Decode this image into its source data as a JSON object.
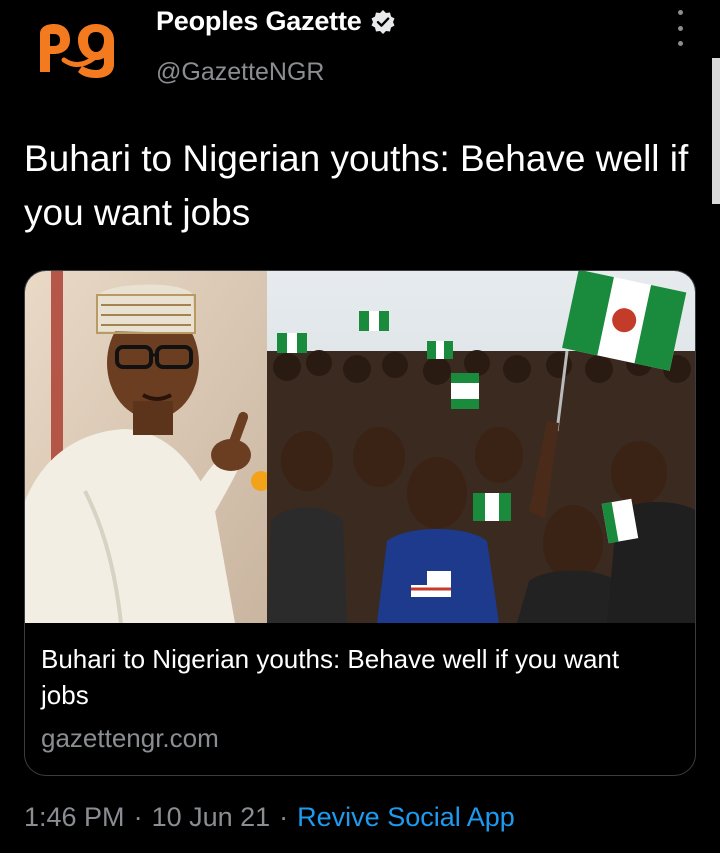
{
  "author": {
    "display_name": "Peoples Gazette",
    "handle": "@GazetteNGR",
    "avatar_icon": "peoples-gazette-logo",
    "verified_icon": "verified-badge-icon",
    "brand_color": "#f47a20"
  },
  "tweet": {
    "text": "Buhari to Nigerian youths: Behave well if you want jobs"
  },
  "card": {
    "title": "Buhari to Nigerian youths: Behave well if you want jobs",
    "domain": "gazettengr.com",
    "image_left": "photo-president-pointing",
    "image_right": "photo-youth-crowd-with-nigerian-flags",
    "flag_color": "#1a8a3c"
  },
  "meta": {
    "time": "1:46 PM",
    "date": "10 Jun 21",
    "separator": "·",
    "source": "Revive Social App",
    "link_color": "#1d9bf0"
  }
}
